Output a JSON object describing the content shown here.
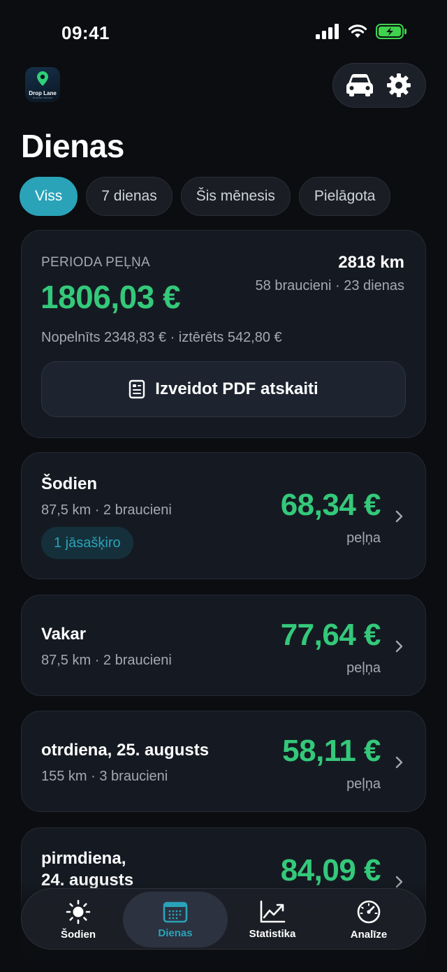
{
  "status_bar": {
    "time": "09:41"
  },
  "app": {
    "logo_name": "Drop Lane",
    "logo_tagline": "MILEAGE TRACKER"
  },
  "header": {
    "title": "Dienas"
  },
  "filters": [
    "Viss",
    "7 dienas",
    "Šis mēnesis",
    "Pielāgota"
  ],
  "summary": {
    "label": "PERIODA PEĻŅA",
    "amount": "1806,03 €",
    "distance": "2818 km",
    "trips_days": "58 braucieni · 23 dienas",
    "earned_spent": "Nopelnīts 2348,83 € · iztērēts 542,80 €",
    "pdf_button": "Izveidot PDF atskaiti"
  },
  "days": [
    {
      "title": "Šodien",
      "subtitle": "87,5 km · 2 braucieni",
      "amount": "68,34 €",
      "caption": "peļņa",
      "badge": "1 jāsašķiro"
    },
    {
      "title": "Vakar",
      "subtitle": "87,5 km · 2 braucieni",
      "amount": "77,64 €",
      "caption": "peļņa"
    },
    {
      "title": "otrdiena, 25. augusts",
      "subtitle": "155 km · 3 braucieni",
      "amount": "58,11 €",
      "caption": "peļņa"
    },
    {
      "title_line1": "pirmdiena,",
      "title_line2": "24. augusts",
      "amount": "84,09 €"
    }
  ],
  "nav": [
    {
      "label": "Šodien",
      "icon": "sun-icon"
    },
    {
      "label": "Dienas",
      "icon": "calendar-icon"
    },
    {
      "label": "Statistika",
      "icon": "chart-line-icon"
    },
    {
      "label": "Analīze",
      "icon": "speedometer-icon"
    }
  ],
  "colors": {
    "accent": "#2aa3b8",
    "profit": "#34c97a",
    "background": "#0b0d11",
    "card": "#151a22"
  }
}
